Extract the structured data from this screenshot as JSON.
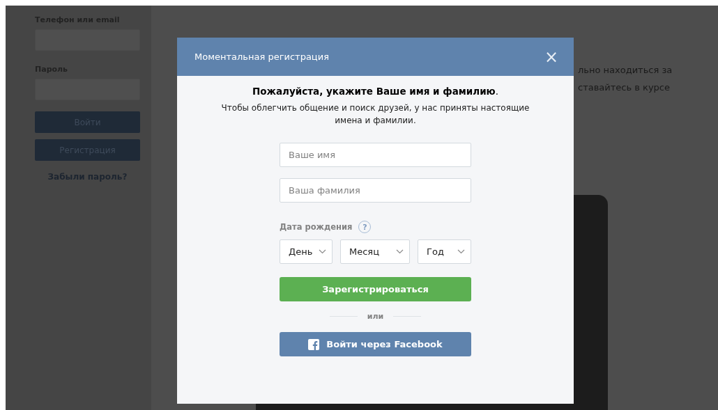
{
  "sidebar": {
    "fields": [
      {
        "label": "Телефон или email"
      },
      {
        "label": "Пароль"
      }
    ],
    "buttons": [
      "Войти",
      "Регистрация"
    ],
    "link": "Забыли пароль?"
  },
  "background_text": [
    "льно находиться за",
    "ставайтесь в курсе"
  ],
  "modal": {
    "title": "Моментальная регистрация",
    "close": "×",
    "heading": "**Пожалуйста, укажите Ваше имя и фамилию**.",
    "subtitle": "Чтобы облегчить общение и поиск друзей, у нас приняты настоящие имена и фамилии.",
    "fields": [
      {
        "placeholder": "Ваше имя"
      },
      {
        "placeholder": "Ваша фамилия"
      }
    ],
    "birth_label": "Дата рождения",
    "help": "?",
    "selects": [
      "День",
      "Месяц",
      "Год"
    ],
    "submit": "Зарегистрироваться",
    "divider": "или",
    "facebook": "Войти через Facebook"
  }
}
